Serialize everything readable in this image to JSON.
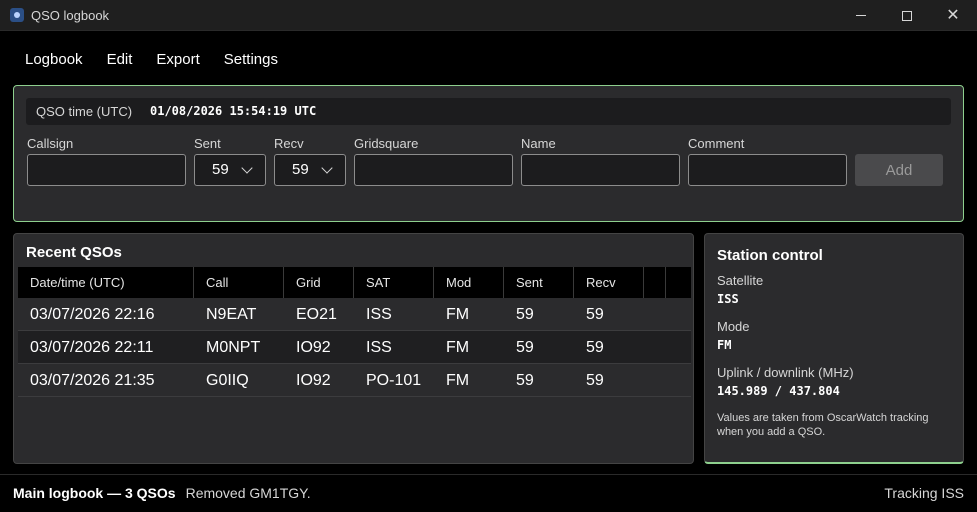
{
  "window": {
    "title": "QSO logbook"
  },
  "menu": [
    "Logbook",
    "Edit",
    "Export",
    "Settings"
  ],
  "entry": {
    "time_label": "QSO time (UTC)",
    "time_value": "01/08/2026 15:54:19 UTC",
    "fields": {
      "callsign_label": "Callsign",
      "callsign_value": "",
      "sent_label": "Sent",
      "sent_value": "59",
      "recv_label": "Recv",
      "recv_value": "59",
      "grid_label": "Gridsquare",
      "grid_value": "",
      "name_label": "Name",
      "name_value": "",
      "comment_label": "Comment",
      "comment_value": ""
    },
    "add_label": "Add"
  },
  "recent": {
    "title": "Recent QSOs",
    "columns": [
      "Date/time (UTC)",
      "Call",
      "Grid",
      "SAT",
      "Mod",
      "Sent",
      "Recv"
    ],
    "rows": [
      [
        "03/07/2026 22:16",
        "N9EAT",
        "EO21",
        "ISS",
        "FM",
        "59",
        "59"
      ],
      [
        "03/07/2026 22:11",
        "M0NPT",
        "IO92",
        "ISS",
        "FM",
        "59",
        "59"
      ],
      [
        "03/07/2026 21:35",
        "G0IIQ",
        "IO92",
        "PO-101",
        "FM",
        "59",
        "59"
      ]
    ]
  },
  "station": {
    "title": "Station control",
    "satellite_label": "Satellite",
    "satellite_value": "ISS",
    "mode_label": "Mode",
    "mode_value": "FM",
    "freq_label": "Uplink / downlink (MHz)",
    "freq_value": "145.989 / 437.804",
    "note": "Values are taken from OscarWatch tracking when you add a QSO."
  },
  "status": {
    "logbook": "Main logbook — 3 QSOs",
    "message": "Removed GM1TGY.",
    "tracking": "Tracking ISS"
  },
  "colors": {
    "accent_border": "#8ed08e",
    "panel_bg": "#2b2b2d",
    "window_bg": "#000000"
  }
}
